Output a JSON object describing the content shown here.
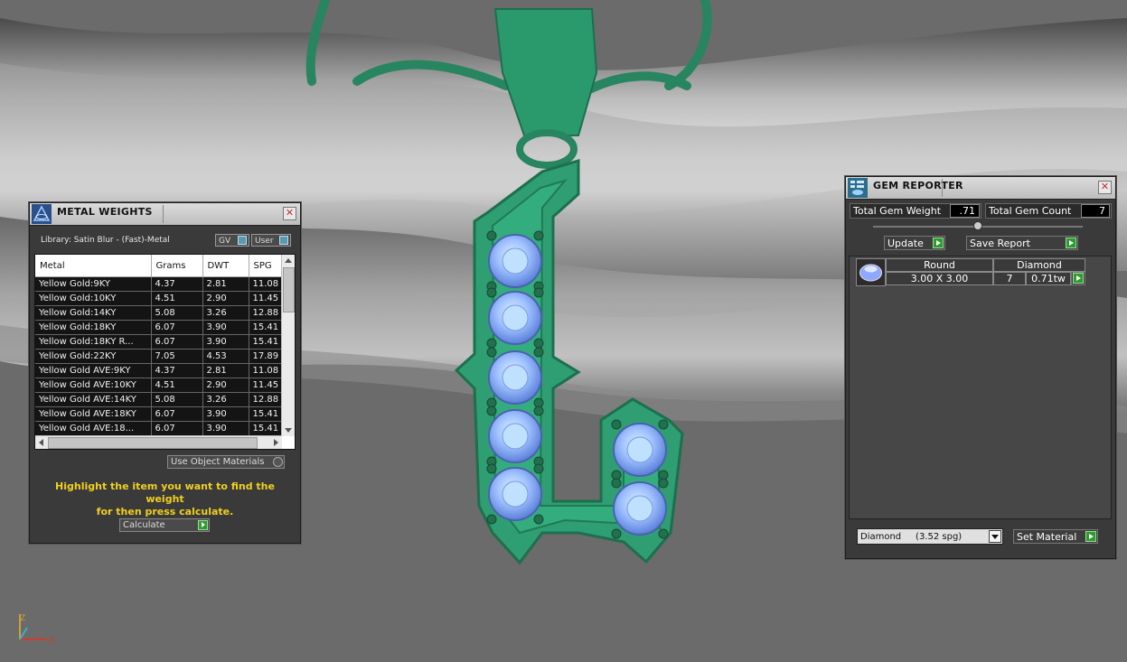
{
  "metal_weights": {
    "title": "METAL WEIGHTS",
    "library_label": "Library: Satin Blur - (Fast)-Metal",
    "gv_label": "GV",
    "user_label": "User",
    "columns": [
      "Metal",
      "Grams",
      "DWT",
      "SPG"
    ],
    "rows": [
      [
        "Yellow Gold:9KY",
        "4.37",
        "2.81",
        "11.08"
      ],
      [
        "Yellow Gold:10KY",
        "4.51",
        "2.90",
        "11.45"
      ],
      [
        "Yellow Gold:14KY",
        "5.08",
        "3.26",
        "12.88"
      ],
      [
        "Yellow Gold:18KY",
        "6.07",
        "3.90",
        "15.41"
      ],
      [
        "Yellow Gold:18KY R...",
        "6.07",
        "3.90",
        "15.41"
      ],
      [
        "Yellow Gold:22KY",
        "7.05",
        "4.53",
        "17.89"
      ],
      [
        "Yellow Gold AVE:9KY",
        "4.37",
        "2.81",
        "11.08"
      ],
      [
        "Yellow Gold AVE:10KY",
        "4.51",
        "2.90",
        "11.45"
      ],
      [
        "Yellow Gold AVE:14KY",
        "5.08",
        "3.26",
        "12.88"
      ],
      [
        "Yellow Gold AVE:18KY",
        "6.07",
        "3.90",
        "15.41"
      ],
      [
        "Yellow Gold AVE:18...",
        "6.07",
        "3.90",
        "15.41"
      ]
    ],
    "use_object_materials_label": "Use Object Materials",
    "hint_line1": "Highlight the item you want to find the weight",
    "hint_line2": "for then press calculate.",
    "calculate_label": "Calculate"
  },
  "gem_reporter": {
    "title": "GEM REPORTER",
    "total_gem_weight_label": "Total Gem Weight",
    "total_gem_weight_value": ".71",
    "total_gem_count_label": "Total Gem Count",
    "total_gem_count_value": "7",
    "update_label": "Update",
    "save_report_label": "Save Report",
    "gem_row": {
      "shape": "Round",
      "material": "Diamond",
      "size": "3.00 X 3.00",
      "count": "7",
      "carat": "0.71tw"
    },
    "material_dropdown": "Diamond     (3.52 spg)",
    "set_material_label": "Set Material"
  },
  "axis": {
    "z": "Z",
    "x": "X"
  },
  "colors": {
    "pendant": "#2f9e72",
    "gem": "#8fb6ff",
    "hint_text": "#f0d020",
    "play_button": "#2f9a2f"
  }
}
